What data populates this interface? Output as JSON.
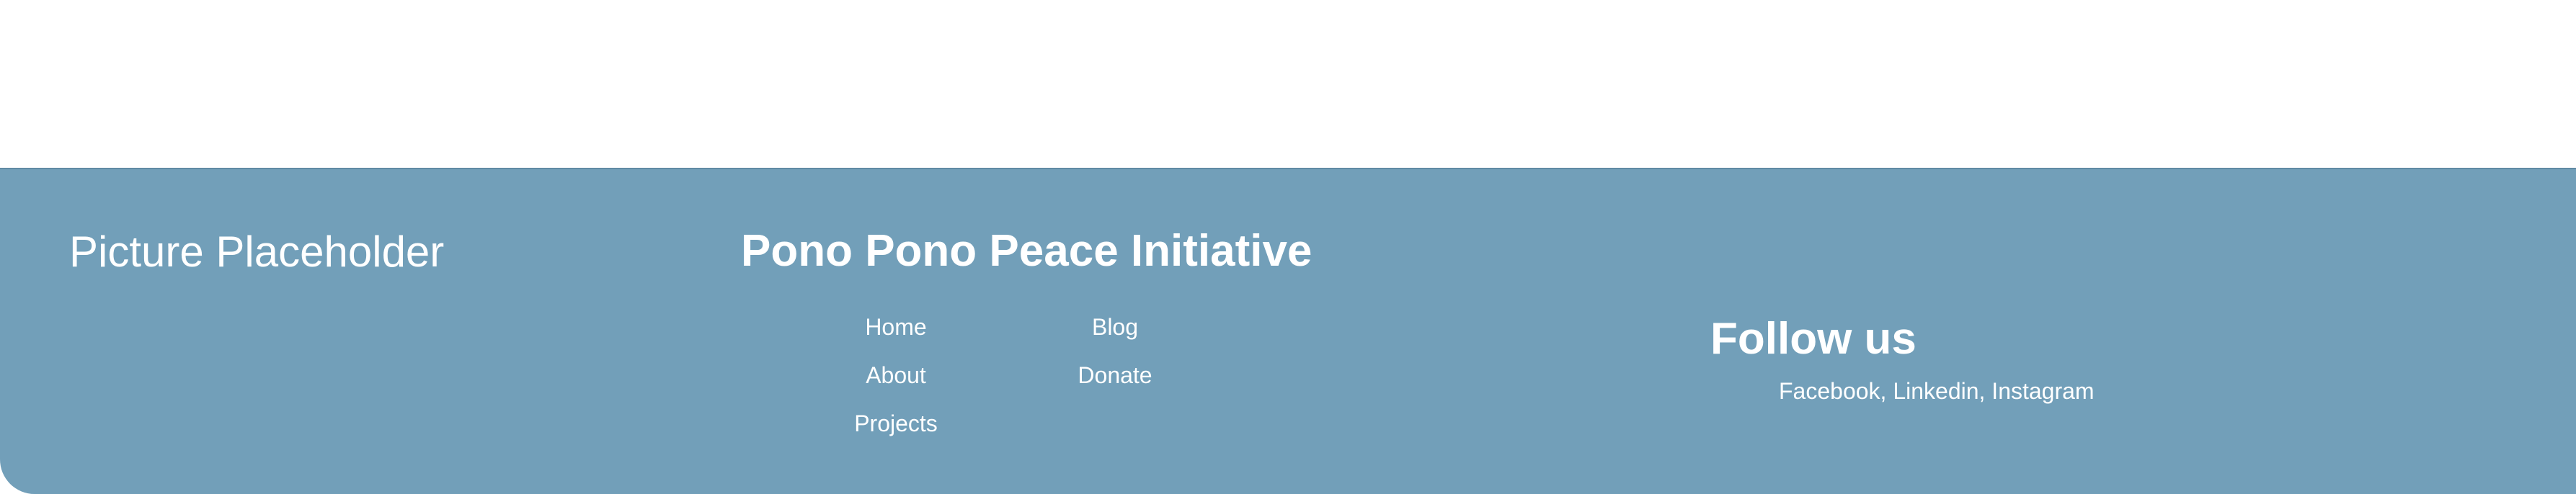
{
  "footer": {
    "picture_placeholder": "Picture Placeholder",
    "org_title": "Pono Pono Peace Initiative",
    "nav": {
      "home": "Home",
      "about": "About",
      "projects": "Projects",
      "blog": "Blog",
      "donate": "Donate"
    },
    "follow_title": "Follow us",
    "social": {
      "facebook": "Facebook",
      "linkedin": "Linkedin",
      "instagram": "Instagram",
      "separator": ", "
    }
  },
  "colors": {
    "footer_background": "#729fb9",
    "text": "#ffffff",
    "page_background": "#ffffff"
  }
}
